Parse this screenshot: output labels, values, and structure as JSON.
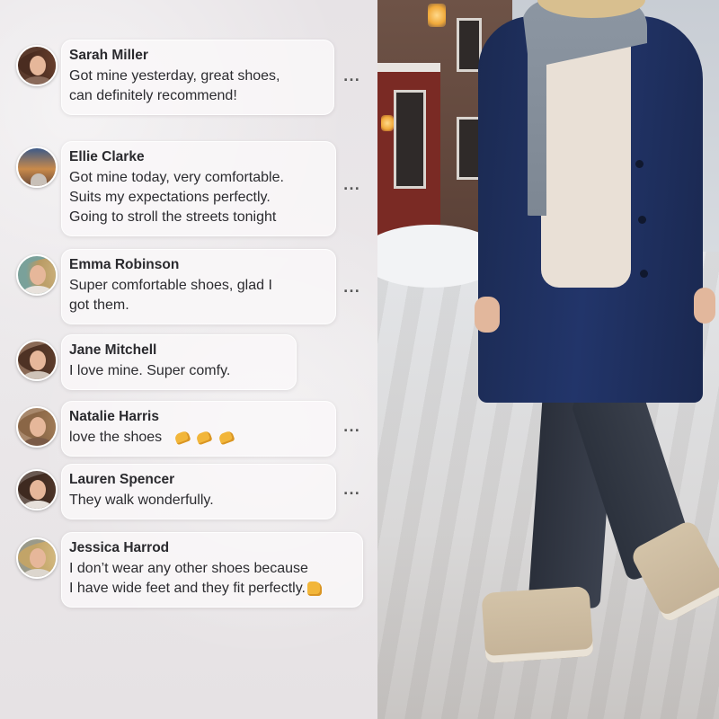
{
  "comments": [
    {
      "name": "Sarah Miller",
      "text": "Got mine yesterday, great shoes, can definitely recommend!",
      "lines": [
        "Got mine yesterday, great shoes,",
        "can definitely recommend!"
      ],
      "has_more": true
    },
    {
      "name": "Ellie Clarke",
      "lines": [
        "Got mine today, very comfortable.",
        "Suits my expectations perfectly.",
        "Going to stroll the streets tonight"
      ],
      "has_more": true
    },
    {
      "name": "Emma Robinson",
      "lines": [
        "Super comfortable shoes, glad I",
        "got them."
      ],
      "has_more": true
    },
    {
      "name": "Jane Mitchell",
      "lines": [
        "I love mine. Super comfy."
      ],
      "has_more": false
    },
    {
      "name": "Natalie Harris",
      "lines": [
        "love the shoes"
      ],
      "emoji": "clapping-hands x3",
      "has_more": true
    },
    {
      "name": "Lauren Spencer",
      "lines": [
        "They walk wonderfully."
      ],
      "has_more": true
    },
    {
      "name": "Jessica Harrod",
      "lines": [
        "I don’t wear any other shoes because",
        "I have wide feet and they fit perfectly."
      ],
      "emoji": "thumbs-up",
      "has_more": false
    }
  ],
  "more_label": "...",
  "photo": {
    "subject": "woman walking on snowy cobblestone street",
    "colors": {
      "coat": "#1e2f5e",
      "boots": "#cdbc9f",
      "snow": "#eef0f3"
    }
  }
}
